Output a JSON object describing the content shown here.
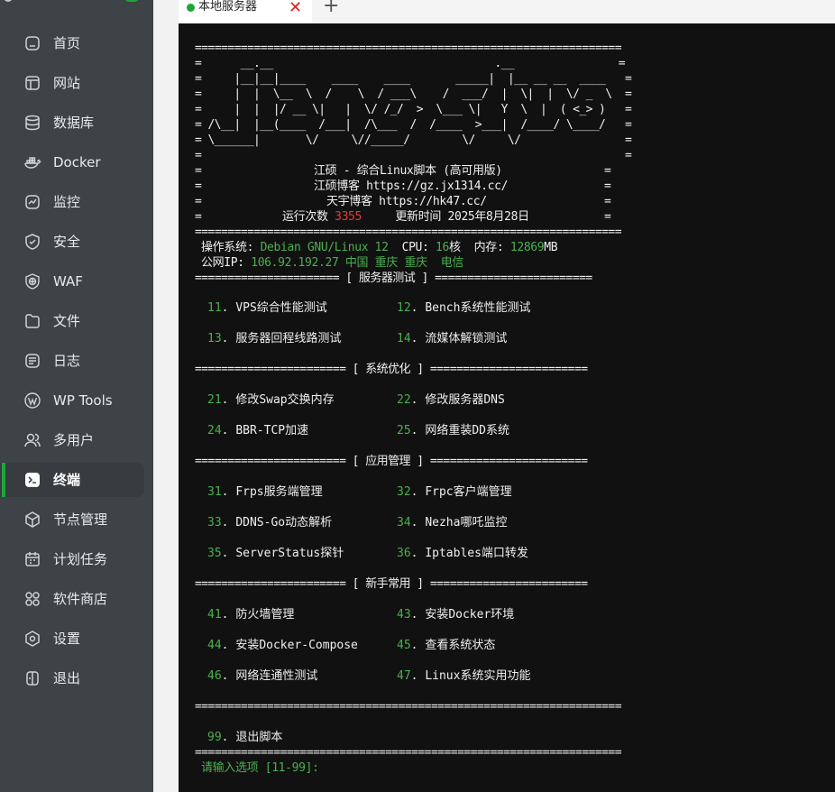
{
  "sidebar": {
    "items": [
      {
        "label": "首页",
        "icon": "home-icon"
      },
      {
        "label": "网站",
        "icon": "website-icon"
      },
      {
        "label": "数据库",
        "icon": "database-icon"
      },
      {
        "label": "Docker",
        "icon": "docker-icon"
      },
      {
        "label": "监控",
        "icon": "monitor-icon"
      },
      {
        "label": "安全",
        "icon": "shield-icon"
      },
      {
        "label": "WAF",
        "icon": "waf-shield-icon"
      },
      {
        "label": "文件",
        "icon": "folder-icon"
      },
      {
        "label": "日志",
        "icon": "log-icon"
      },
      {
        "label": "WP Tools",
        "icon": "wordpress-icon"
      },
      {
        "label": "多用户",
        "icon": "users-icon"
      },
      {
        "label": "终端",
        "icon": "terminal-icon"
      },
      {
        "label": "节点管理",
        "icon": "node-cube-icon"
      },
      {
        "label": "计划任务",
        "icon": "calendar-icon"
      },
      {
        "label": "软件商店",
        "icon": "apps-grid-icon"
      },
      {
        "label": "设置",
        "icon": "settings-icon"
      },
      {
        "label": "退出",
        "icon": "logout-icon"
      }
    ],
    "active": "终端",
    "accent_color": "#20a53a"
  },
  "tabs": {
    "items": [
      {
        "label": "本地服务器",
        "status_color": "#20a53a"
      }
    ],
    "add_label": "+"
  },
  "terminal": {
    "border_line": "=================================================================",
    "banner": [
      "=      __.__                                  .__                =",
      "=     |__|__|____    ____    ____       _____|  |__ __ __  ____   =",
      "=     |  |  \\__  \\  /    \\  / ___\\    /  ___/  |  \\|  |  \\/ _  \\  =",
      "=     |  |  |/ __ \\|   |  \\/ /_/  >  \\___ \\|   Y  \\  |  ( <_> )   =",
      "= /\\__|  |__(____  /___|  /\\___  /  /____  >___|  /____/ \\____/   =",
      "= \\______|       \\/     \\//_____/        \\/     \\/                =",
      "=                                                                 ="
    ],
    "info": {
      "title": "江硕 - 综合Linux脚本 (高可用版)",
      "blog1_label": "江硕博客",
      "blog1_url": "https://gz.jx1314.cc/",
      "blog2_label": "天宇博客",
      "blog2_url": "https://hk47.cc/",
      "runs_label": "运行次数",
      "runs_value": "3355",
      "updated_label": "更新时间",
      "updated_value": "2025年8月28日"
    },
    "sysinfo": {
      "os_label": "操作系统:",
      "os_value": "Debian GNU/Linux 12",
      "cpu_label": "CPU:",
      "cpu_value": "16",
      "cpu_unit": "核",
      "mem_label": "内存:",
      "mem_value": "12869",
      "mem_unit": "MB",
      "ip_label": "公网IP:",
      "ip_value": "106.92.192.27",
      "ip_location": "中国 重庆 重庆  电信"
    },
    "sections": [
      {
        "left": "======================",
        "title": "[ 服务器测试 ]",
        "right": "========================",
        "items": [
          {
            "n": "11",
            "label": "VPS综合性能测试"
          },
          {
            "n": "12",
            "label": "Bench系统性能测试"
          },
          {
            "n": "13",
            "label": "服务器回程线路测试"
          },
          {
            "n": "14",
            "label": "流媒体解锁测试"
          }
        ]
      },
      {
        "left": "=======================",
        "title": "[ 系统优化 ]",
        "right": "========================",
        "items": [
          {
            "n": "21",
            "label": "修改Swap交换内存"
          },
          {
            "n": "22",
            "label": "修改服务器DNS"
          },
          {
            "n": "24",
            "label": "BBR-TCP加速"
          },
          {
            "n": "25",
            "label": "网络重装DD系统"
          }
        ]
      },
      {
        "left": "=======================",
        "title": "[ 应用管理 ]",
        "right": "========================",
        "items": [
          {
            "n": "31",
            "label": "Frps服务端管理"
          },
          {
            "n": "32",
            "label": "Frpc客户端管理"
          },
          {
            "n": "33",
            "label": "DDNS-Go动态解析"
          },
          {
            "n": "34",
            "label": "Nezha哪吒监控"
          },
          {
            "n": "35",
            "label": "ServerStatus探针"
          },
          {
            "n": "36",
            "label": "Iptables端口转发"
          }
        ]
      },
      {
        "left": "=======================",
        "title": "[ 新手常用 ]",
        "right": "========================",
        "items": [
          {
            "n": "41",
            "label": "防火墙管理"
          },
          {
            "n": "43",
            "label": "安装Docker环境"
          },
          {
            "n": "44",
            "label": "安装Docker-Compose"
          },
          {
            "n": "45",
            "label": "查看系统状态"
          },
          {
            "n": "46",
            "label": "网络连通性测试"
          },
          {
            "n": "47",
            "label": "Linux系统实用功能"
          }
        ]
      }
    ],
    "exit_item": {
      "n": "99",
      "label": "退出脚本"
    },
    "prompt": "请输入选项 [11-99]:",
    "colors": {
      "green": "#4caf50",
      "red": "#e53935",
      "background": "#111111"
    }
  }
}
